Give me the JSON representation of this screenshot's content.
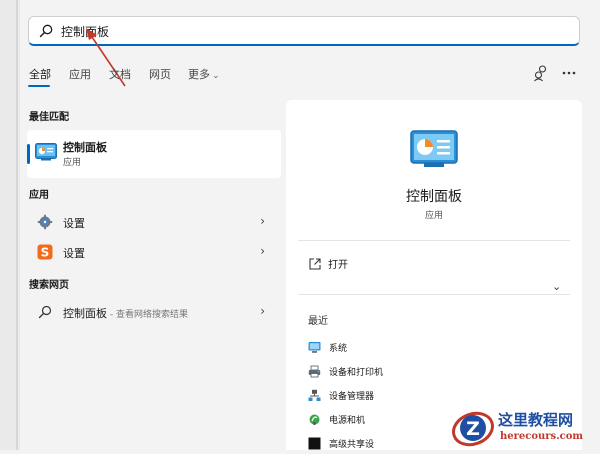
{
  "search": {
    "value": "控制面板"
  },
  "tabs": [
    {
      "label": "全部"
    },
    {
      "label": "应用"
    },
    {
      "label": "文档"
    },
    {
      "label": "网页"
    },
    {
      "label": "更多"
    }
  ],
  "accent_color": "#0067c0",
  "best_match": {
    "section_title": "最佳匹配",
    "title": "控制面板",
    "subtitle": "应用"
  },
  "apps": {
    "section_title": "应用",
    "items": [
      {
        "label": "设置",
        "icon": "gear-icon"
      },
      {
        "label": "设置",
        "icon": "sogou-s-icon"
      }
    ]
  },
  "web": {
    "section_title": "搜索网页",
    "item": {
      "label": "控制面板",
      "suffix": " - 查看网络搜索结果"
    }
  },
  "detail": {
    "title": "控制面板",
    "subtitle": "应用",
    "open_label": "打开",
    "recent_title": "最近",
    "recent": [
      {
        "label": "系统",
        "icon": "system-icon"
      },
      {
        "label": "设备和打印机",
        "icon": "printer-icon"
      },
      {
        "label": "设备管理器",
        "icon": "device-manager-icon"
      },
      {
        "label": "电源和机",
        "icon": "power-icon"
      },
      {
        "label": "高级共享设",
        "icon": "sharing-icon"
      }
    ]
  },
  "watermark": {
    "title": "这里教程网",
    "domain": "herecours.com"
  }
}
